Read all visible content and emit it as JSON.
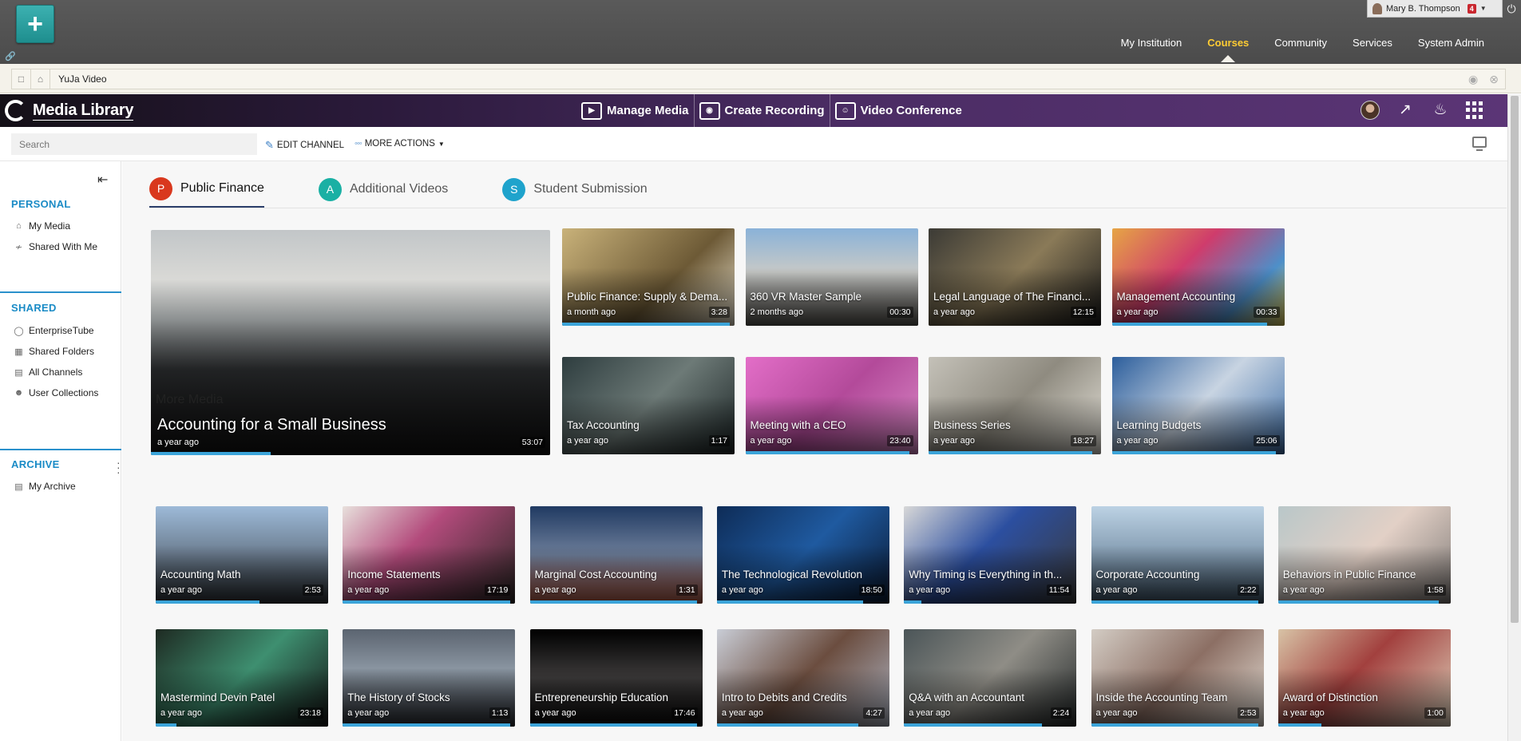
{
  "lms": {
    "user_name": "Mary B. Thompson",
    "notification_count": "4",
    "nav": [
      "My Institution",
      "Courses",
      "Community",
      "Services",
      "System Admin"
    ],
    "active_nav": "Courses"
  },
  "breadcrumb": {
    "text": "YuJa Video"
  },
  "header": {
    "app_title": "Media Library",
    "actions": [
      "Manage Media",
      "Create Recording",
      "Video Conference"
    ]
  },
  "toolbar": {
    "search_placeholder": "Search",
    "edit_channel": "EDIT CHANNEL",
    "more_actions": "MORE ACTIONS"
  },
  "sidebar": {
    "sections": [
      {
        "title": "PERSONAL",
        "items": [
          "My Media",
          "Shared With Me"
        ]
      },
      {
        "title": "SHARED",
        "items": [
          "EnterpriseTube",
          "Shared Folders",
          "All Channels",
          "User Collections"
        ]
      },
      {
        "title": "ARCHIVE",
        "items": [
          "My Archive"
        ]
      }
    ]
  },
  "tabs": [
    {
      "letter": "P",
      "label": "Public Finance",
      "color": "#d9381e",
      "active": true
    },
    {
      "letter": "A",
      "label": "Additional Videos",
      "color": "#1ab0a4",
      "active": false
    },
    {
      "letter": "S",
      "label": "Student Submission",
      "color": "#1fa3cc",
      "active": false
    }
  ],
  "featured": {
    "title": "Accounting for a Small Business",
    "date": "a year ago",
    "duration": "53:07",
    "progress": 0.3
  },
  "channel_videos": [
    {
      "title": "Public Finance: Supply & Dema...",
      "date": "a month ago",
      "duration": "3:28",
      "progress": 0.97
    },
    {
      "title": "360 VR Master Sample",
      "date": "2 months ago",
      "duration": "00:30",
      "progress": 0.0
    },
    {
      "title": "Legal Language of The Financi...",
      "date": "a year ago",
      "duration": "12:15",
      "progress": 0.0
    },
    {
      "title": "Management Accounting",
      "date": "a year ago",
      "duration": "00:33",
      "progress": 0.9
    },
    {
      "title": "Tax Accounting",
      "date": "a year ago",
      "duration": "1:17",
      "progress": 0.0
    },
    {
      "title": "Meeting with a CEO",
      "date": "a year ago",
      "duration": "23:40",
      "progress": 0.95
    },
    {
      "title": "Business Series",
      "date": "a year ago",
      "duration": "18:27",
      "progress": 0.95
    },
    {
      "title": "Learning Budgets",
      "date": "a year ago",
      "duration": "25:06",
      "progress": 0.95
    }
  ],
  "more_media_title": "More Media",
  "more_media": [
    {
      "title": "Accounting Math",
      "date": "a year ago",
      "duration": "2:53",
      "progress": 0.6
    },
    {
      "title": "Income Statements",
      "date": "a year ago",
      "duration": "17:19",
      "progress": 0.97
    },
    {
      "title": "Marginal Cost Accounting",
      "date": "a year ago",
      "duration": "1:31",
      "progress": 0.97
    },
    {
      "title": "The Technological Revolution",
      "date": "a year ago",
      "duration": "18:50",
      "progress": 0.85
    },
    {
      "title": "Why Timing is Everything in th...",
      "date": "a year ago",
      "duration": "11:54",
      "progress": 0.1
    },
    {
      "title": "Corporate Accounting",
      "date": "a year ago",
      "duration": "2:22",
      "progress": 0.97
    },
    {
      "title": "Behaviors in Public Finance",
      "date": "a year ago",
      "duration": "1:58",
      "progress": 0.93
    },
    {
      "title": "Mastermind Devin Patel",
      "date": "a year ago",
      "duration": "23:18",
      "progress": 0.12
    },
    {
      "title": "The History of Stocks",
      "date": "a year ago",
      "duration": "1:13",
      "progress": 0.97
    },
    {
      "title": "Entrepreneurship Education",
      "date": "a year ago",
      "duration": "17:46",
      "progress": 0.97
    },
    {
      "title": "Intro to Debits and Credits",
      "date": "a year ago",
      "duration": "4:27",
      "progress": 0.82
    },
    {
      "title": "Q&A with an Accountant",
      "date": "a year ago",
      "duration": "2:24",
      "progress": 0.8
    },
    {
      "title": "Inside the Accounting Team",
      "date": "a year ago",
      "duration": "2:53",
      "progress": 0.97
    },
    {
      "title": "Award of Distinction",
      "date": "a year ago",
      "duration": "1:00",
      "progress": 0.25
    }
  ]
}
